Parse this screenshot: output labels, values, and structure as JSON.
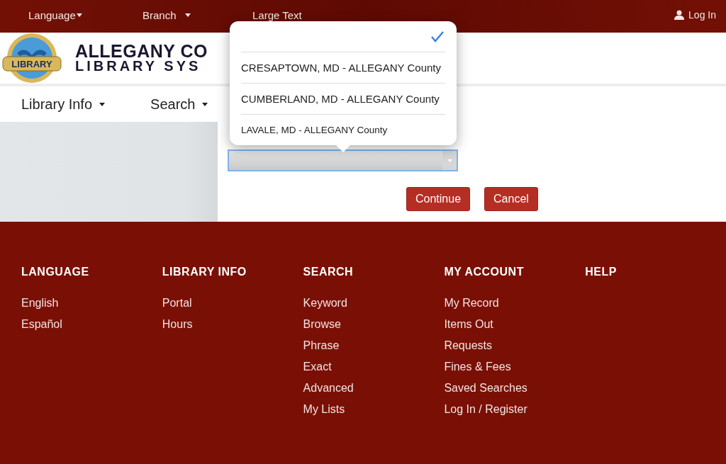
{
  "top_bar": {
    "items": [
      {
        "label": "Language",
        "kind": "dropdown"
      },
      {
        "label": "Branch",
        "kind": "dropdown"
      },
      {
        "label": "Large Text",
        "kind": "link"
      }
    ],
    "login": "Log In"
  },
  "header": {
    "title_line_1": "ALLEGANY CO",
    "title_line_2": "LIBRARY SYS",
    "logo_text": "LIBRARY"
  },
  "nav": [
    {
      "label": "Library Info"
    },
    {
      "label": "Search"
    }
  ],
  "picker": {
    "blank_option_selected": true,
    "options": [
      {
        "label": "CRESAPTOWN, MD - ALLEGANY County",
        "selected": false
      },
      {
        "label": "CUMBERLAND, MD - ALLEGANY County",
        "selected": false
      },
      {
        "label": "LAVALE, MD - ALLEGANY County",
        "selected": false
      }
    ]
  },
  "buttons": [
    "Continue",
    "Cancel"
  ],
  "footer": [
    {
      "heading": "LANGUAGE",
      "links": [
        "English",
        "Español"
      ]
    },
    {
      "heading": "LIBRARY INFO",
      "links": [
        "Portal",
        "Hours"
      ]
    },
    {
      "heading": "SEARCH",
      "links": [
        "Keyword",
        "Browse",
        "Phrase",
        "Exact",
        "Advanced",
        "My Lists"
      ]
    },
    {
      "heading": "MY ACCOUNT",
      "links": [
        "My Record",
        "Items Out",
        "Requests",
        "Fines & Fees",
        "Saved Searches",
        "Log In / Register"
      ]
    },
    {
      "heading": "HELP"
    }
  ]
}
